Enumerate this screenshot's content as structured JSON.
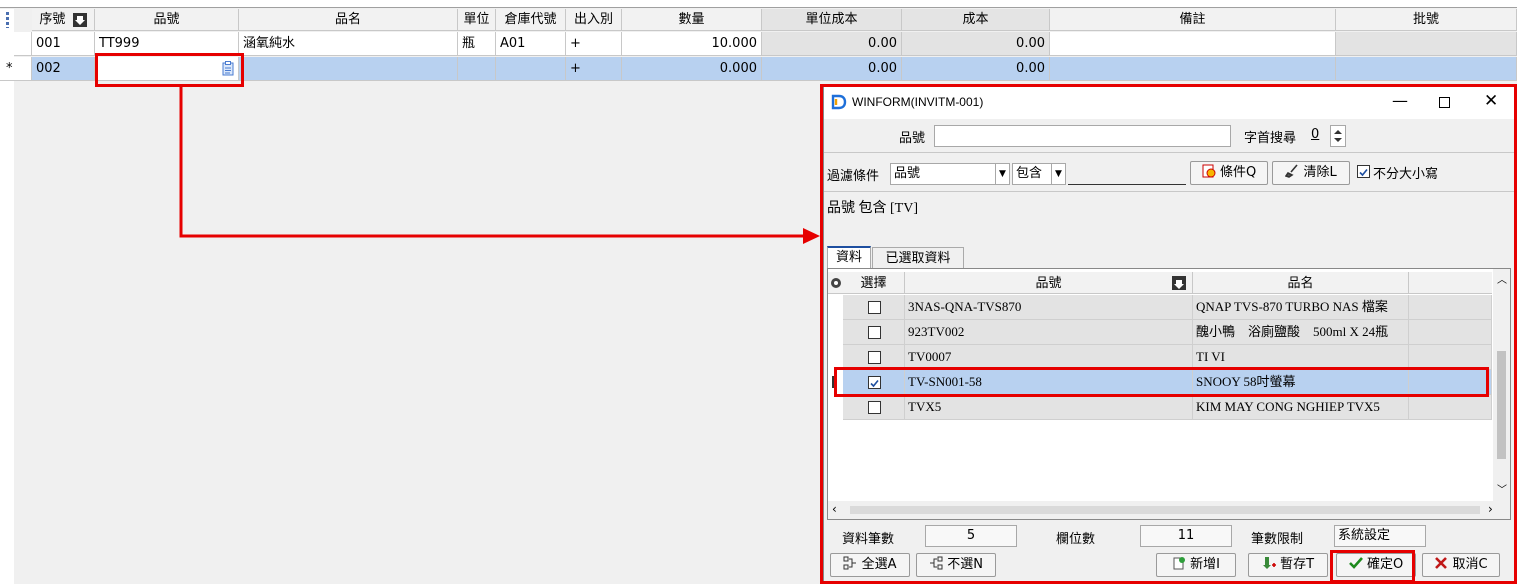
{
  "grid": {
    "headers": [
      "序號",
      "品號",
      "品名",
      "單位",
      "倉庫代號",
      "出入別",
      "數量",
      "單位成本",
      "成本",
      "備註",
      "批號"
    ],
    "rows": [
      {
        "marker": "",
        "seq": "001",
        "item_no": "TT999",
        "item_name": "涵氧純水",
        "unit": "瓶",
        "warehouse": "A01",
        "io": "+",
        "qty": "10.000",
        "unit_cost": "0.00",
        "cost": "0.00",
        "note": "",
        "lot": ""
      },
      {
        "marker": "*",
        "seq": "002",
        "item_no": "",
        "item_name": "",
        "unit": "",
        "warehouse": "",
        "io": "+",
        "qty": "0.000",
        "unit_cost": "0.00",
        "cost": "0.00",
        "note": "",
        "lot": ""
      }
    ]
  },
  "dialog": {
    "title": "WINFORM(INVITM-001)",
    "item_no_label": "品號",
    "item_no_value": "",
    "prefix_search_label": "字首搜尋",
    "prefix_search_value": "0",
    "filter_label": "過濾條件",
    "filter_field": "品號",
    "filter_op": "包含",
    "filter_value": "",
    "condition_button": "條件Q",
    "clear_button": "清除L",
    "case_insensitive_label": "不分大小寫",
    "case_insensitive_checked": true,
    "criteria_text": "品號 包含 [TV]",
    "tabs": [
      "資料",
      "已選取資料"
    ],
    "list_headers": [
      "選擇",
      "品號",
      "品名"
    ],
    "list_rows": [
      {
        "checked": false,
        "item_no": "3NAS-QNA-TVS870",
        "item_name": "QNAP TVS-870 TURBO NAS 檔案"
      },
      {
        "checked": false,
        "item_no": "923TV002",
        "item_name": "醜小鴨　浴廁鹽酸　500ml X 24瓶"
      },
      {
        "checked": false,
        "item_no": "TV0007",
        "item_name": "TI VI"
      },
      {
        "checked": true,
        "item_no": "TV-SN001-58",
        "item_name": "SNOOY 58吋螢幕"
      },
      {
        "checked": false,
        "item_no": "TVX5",
        "item_name": "KIM MAY CONG NGHIEP TVX5"
      }
    ],
    "record_count_label": "資料筆數",
    "record_count": "5",
    "column_count_label": "欄位數",
    "column_count": "11",
    "limit_label": "筆數限制",
    "limit_value": "系統設定",
    "buttons": {
      "select_all": "全選A",
      "deselect": "不選N",
      "add_new": "新增I",
      "temp_save": "暫存T",
      "confirm": "確定O",
      "cancel": "取消C"
    },
    "accent": "#e60000",
    "selection_color": "#b8d1f0"
  }
}
